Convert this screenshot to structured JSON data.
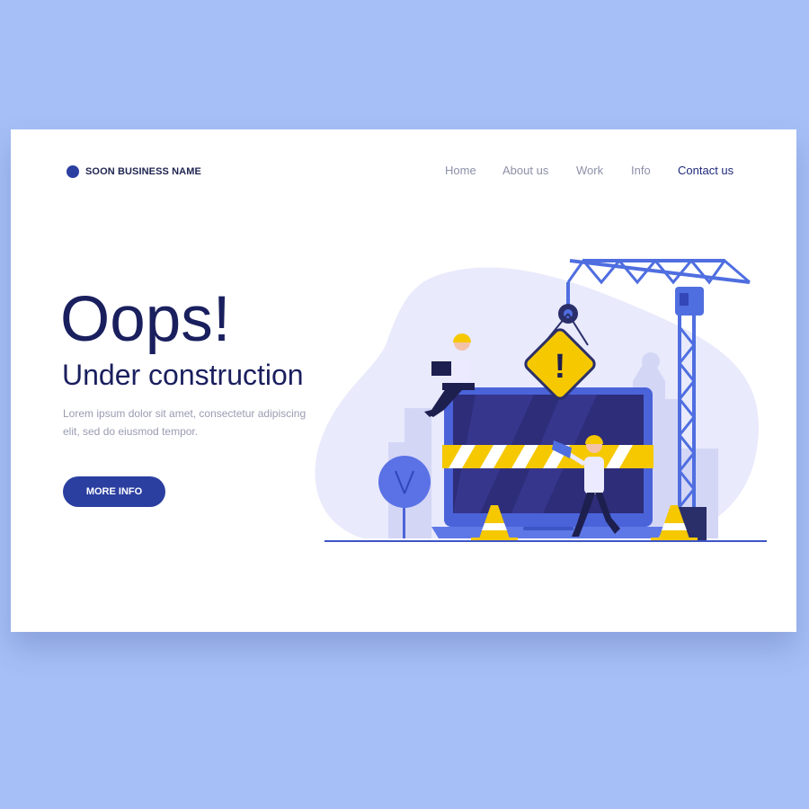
{
  "brand": {
    "name": "SOON BUSINESS NAME"
  },
  "nav": {
    "items": [
      "Home",
      "About us",
      "Work",
      "Info",
      "Contact us"
    ],
    "active": "Contact us"
  },
  "hero": {
    "title": "Oops!",
    "subtitle": "Under construction",
    "body": "Lorem ipsum dolor sit amet, consectetur adipiscing elit, sed do eiusmod tempor.",
    "cta_label": "MORE INFO"
  },
  "colors": {
    "background": "#a6bff6",
    "primary": "#2b3fa0",
    "heading": "#1a1f5e",
    "accent_yellow": "#f5c800",
    "crane_blue": "#4f6ee0"
  },
  "illustration": {
    "warning_sign_text": "!",
    "icons": [
      "crane",
      "warning-sign",
      "laptop",
      "traffic-cone",
      "tree",
      "megaphone",
      "hard-hat"
    ]
  }
}
